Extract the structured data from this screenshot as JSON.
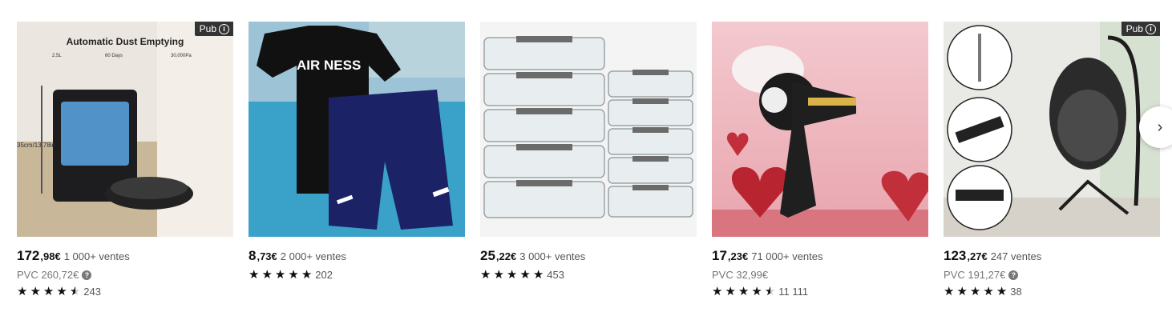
{
  "ad_badge": "Pub",
  "products": [
    {
      "image_heading": "Automatic Dust Emptying",
      "image_features": [
        "2.5L",
        "60 Days",
        "30,000Pa"
      ],
      "image_dimension": "35cm/13.78in",
      "price_int": "172",
      "price_dec": ",98€",
      "sales": "1 000+ ventes",
      "pvc": "PVC 260,72€",
      "rating_count": "243",
      "stars": 4.5,
      "sponsored": true
    },
    {
      "image_brand": "AIR NESS",
      "price_int": "8",
      "price_dec": ",73€",
      "sales": "2 000+ ventes",
      "pvc": "",
      "rating_count": "202",
      "stars": 5,
      "sponsored": false
    },
    {
      "price_int": "25",
      "price_dec": ",22€",
      "sales": "3 000+ ventes",
      "pvc": "",
      "rating_count": "453",
      "stars": 5,
      "sponsored": false
    },
    {
      "price_int": "17",
      "price_dec": ",23€",
      "sales": "71 000+ ventes",
      "pvc": "PVC 32,99€",
      "rating_count": "11 111",
      "stars": 4.5,
      "sponsored": false
    },
    {
      "price_int": "123",
      "price_dec": ",27€",
      "sales": "247 ventes",
      "pvc": "PVC 191,27€",
      "rating_count": "38",
      "stars": 5,
      "sponsored": true
    }
  ],
  "next_icon": "chevron-right-icon"
}
